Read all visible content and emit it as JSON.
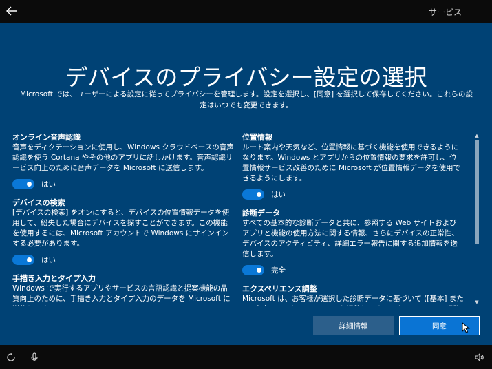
{
  "topbar": {
    "back_icon": "back-arrow-icon",
    "tab_label": "サービス"
  },
  "page": {
    "title": "デバイスのプライバシー設定の選択",
    "subtitle": "Microsoft では、ユーザーによる設定に従ってプライバシーを管理します。設定を選択し、[同意] を選択して保存してください。これらの設定はいつでも変更できます。"
  },
  "left_sections": [
    {
      "title": "オンライン音声認識",
      "body": "音声をディクテーションに使用し、Windows クラウドベースの音声認識を使う Cortana やその他のアプリに話しかけます。音声認識サービス向上のために音声データを Microsoft に送信します。",
      "toggle_on": true,
      "toggle_label": "はい"
    },
    {
      "title": "デバイスの検索",
      "body": "[デバイスの検索] をオンにすると、デバイスの位置情報データを使用して、紛失した場合にデバイスを探すことができます。この機能を使用するには、Microsoft アカウントで Windows にサインインする必要があります。",
      "toggle_on": true,
      "toggle_label": "はい"
    },
    {
      "title": "手描き入力とタイプ入力",
      "body": "Windows で実行するアプリやサービスの言語認識と提案機能の品質向上のために、手描き入力とタイプ入力のデータを Microsoft に送信します。"
    }
  ],
  "right_sections": [
    {
      "title": "位置情報",
      "body": "ルート案内や天気など、位置情報に基づく機能を使用できるようになります。Windows とアプリからの位置情報の要求を許可し、位置情報サービス改善のために Microsoft が位置情報データを使用できるようにします。",
      "toggle_on": true,
      "toggle_label": "はい"
    },
    {
      "title": "診断データ",
      "body": "すべての基本的な診断データと共に、参照する Web サイトおよびアプリと機能の使用方法に関する情報、さらにデバイスの正常性、デバイスのアクティビティ、詳細エラー報告に関する追加情報を送信します。",
      "toggle_on": true,
      "toggle_label": "完全"
    },
    {
      "title": "エクスペリエンス調整",
      "body": "Microsoft は、お客様が選択した診断データに基づいて ([基本] または [完全])、エクスペリエンスを調整します。エクスペリエンス調整により、カスタマイズされたヒント、広告、提案を表示し、Microsoft の"
    }
  ],
  "buttons": {
    "details_label": "詳細情報",
    "agree_label": "同意"
  },
  "bottombar": {
    "icons": [
      "accessibility-icon",
      "microphone-icon",
      "volume-icon"
    ]
  },
  "colors": {
    "background": "#004275",
    "toggle_on": "#0a78d7",
    "bar": "#0b0b0b"
  }
}
